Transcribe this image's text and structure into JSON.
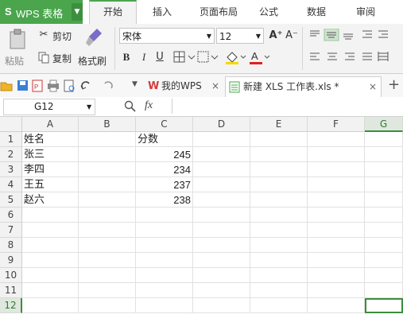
{
  "app": {
    "logo": "S",
    "title": "WPS 表格",
    "arrow": "▼"
  },
  "menu_tabs": [
    "开始",
    "插入",
    "页面布局",
    "公式",
    "数据",
    "审阅"
  ],
  "ribbon": {
    "paste": "粘贴",
    "cut": "剪切",
    "copy": "复制",
    "format_painter": "格式刷",
    "font_name": "宋体",
    "font_size": "12",
    "grow_font": "A⁺",
    "shrink_font": "A⁻",
    "bold": "B",
    "italic": "I",
    "underline": "U"
  },
  "doc_tabs": [
    {
      "label": "我的WPS",
      "close": "×"
    },
    {
      "label": "新建 XLS 工作表.xls *",
      "close": "×"
    }
  ],
  "new_tab": "+",
  "formula_bar": {
    "cell_ref": "G12",
    "fx": "fx",
    "formula": ""
  },
  "columns": [
    "A",
    "B",
    "C",
    "D",
    "E",
    "F",
    "G"
  ],
  "rows": [
    "1",
    "2",
    "3",
    "4",
    "5",
    "6",
    "7",
    "8",
    "9",
    "10",
    "11",
    "12"
  ],
  "cells": {
    "A1": "姓名",
    "C1": "分数",
    "A2": "张三",
    "C2": "245",
    "A3": "李四",
    "C3": "234",
    "A4": "王五",
    "C4": "237",
    "A5": "赵六",
    "C5": "238"
  },
  "colors": {
    "accent": "#4aa54d",
    "header_bg": "#f2f2f2"
  }
}
